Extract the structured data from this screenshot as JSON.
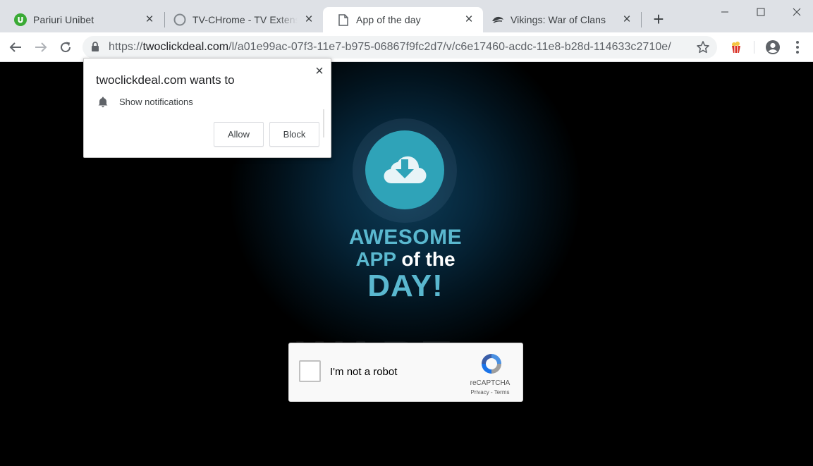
{
  "tabs": [
    {
      "title": "Pariuri Unibet",
      "icon": "unibet-icon"
    },
    {
      "title": "TV-CHrome - TV Extension",
      "icon": "circle-icon"
    },
    {
      "title": "App of the day",
      "icon": "document-icon",
      "active": true
    },
    {
      "title": "Vikings: War of Clans",
      "icon": "vikings-icon"
    }
  ],
  "window": {
    "new_tab": "+"
  },
  "toolbar": {
    "url_scheme": "https://",
    "url_host": "twoclickdeal.com",
    "url_path": "/l/a01e99ac-07f3-11e7-b975-06867f9fc2d7/v/c6e17460-acdc-11e8-b28d-114633c2710e/"
  },
  "permission": {
    "title": "twoclickdeal.com wants to",
    "item": "Show notifications",
    "allow": "Allow",
    "block": "Block",
    "close": "×"
  },
  "hero": {
    "line1": "AWESOME",
    "line2a": "APP",
    "line2b": "of the",
    "line3": "DAY!",
    "watermark": "WARE"
  },
  "captcha": {
    "label": "I'm not a robot",
    "brand": "reCAPTCHA",
    "links": "Privacy - Terms"
  },
  "colors": {
    "accent": "#2fa3b8",
    "headline": "#5ab8cf",
    "unibet": "#3aaa35"
  }
}
